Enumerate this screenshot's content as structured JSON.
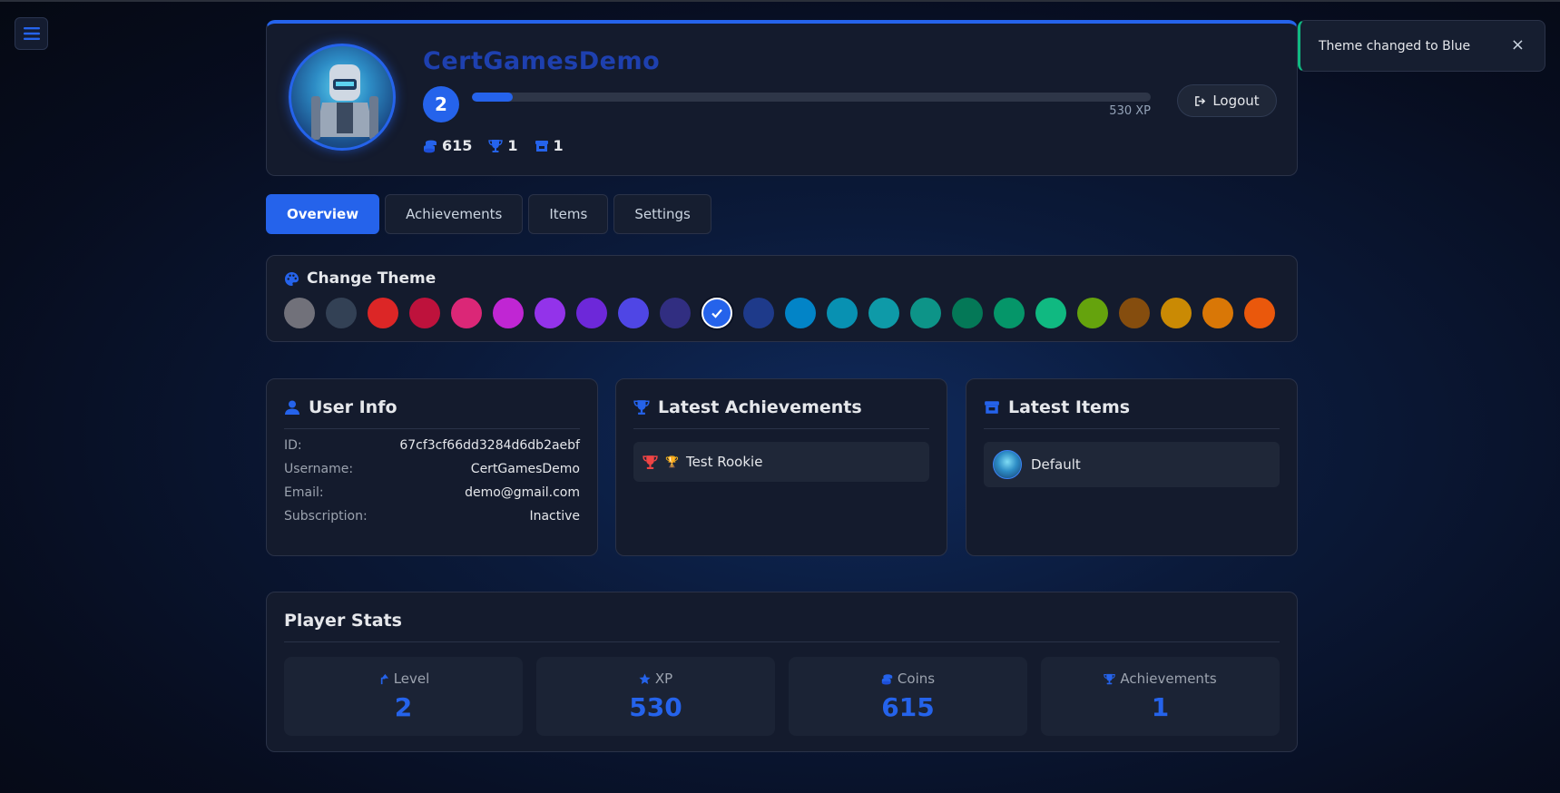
{
  "profile": {
    "username": "CertGamesDemo",
    "level": "2",
    "xp_text": "530 XP",
    "xp_progress": 0.06,
    "coins": "615",
    "achievements": "1",
    "items": "1",
    "logout_label": "Logout"
  },
  "toast": {
    "message": "Theme changed to Blue",
    "close": "×"
  },
  "tabs": [
    {
      "label": "Overview",
      "active": true
    },
    {
      "label": "Achievements"
    },
    {
      "label": "Items"
    },
    {
      "label": "Settings"
    }
  ],
  "theme": {
    "title": "Change Theme",
    "swatches": [
      "#71717a",
      "#334155",
      "#dc2626",
      "#be123c",
      "#db2777",
      "#c026d3",
      "#9333ea",
      "#6d28d9",
      "#4f46e5",
      "#312e81",
      "#2563eb",
      "#1e3a8a",
      "#0284c7",
      "#0891b2",
      "#0e9aa8",
      "#0d9488",
      "#047857",
      "#059669",
      "#10b981",
      "#65a30d",
      "#854d0e",
      "#ca8a04",
      "#d97706",
      "#ea580c"
    ],
    "selected_index": 10
  },
  "user_info": {
    "title": "User Info",
    "rows": [
      {
        "key": "ID:",
        "value": "67cf3cf66dd3284d6db2aebf"
      },
      {
        "key": "Username:",
        "value": "CertGamesDemo"
      },
      {
        "key": "Email:",
        "value": "demo@gmail.com"
      },
      {
        "key": "Subscription:",
        "value": "Inactive"
      }
    ]
  },
  "latest_achievements": {
    "title": "Latest Achievements",
    "items": [
      {
        "emoji": "🏆",
        "label": "Test Rookie"
      }
    ]
  },
  "latest_items": {
    "title": "Latest Items",
    "items": [
      {
        "label": "Default"
      }
    ]
  },
  "player_stats": {
    "title": "Player Stats",
    "stats": [
      {
        "label": "Level",
        "value": "2"
      },
      {
        "label": "XP",
        "value": "530"
      },
      {
        "label": "Coins",
        "value": "615"
      },
      {
        "label": "Achievements",
        "value": "1"
      }
    ]
  },
  "colors": {
    "accent": "#2563eb",
    "toast_border": "#10b981"
  }
}
